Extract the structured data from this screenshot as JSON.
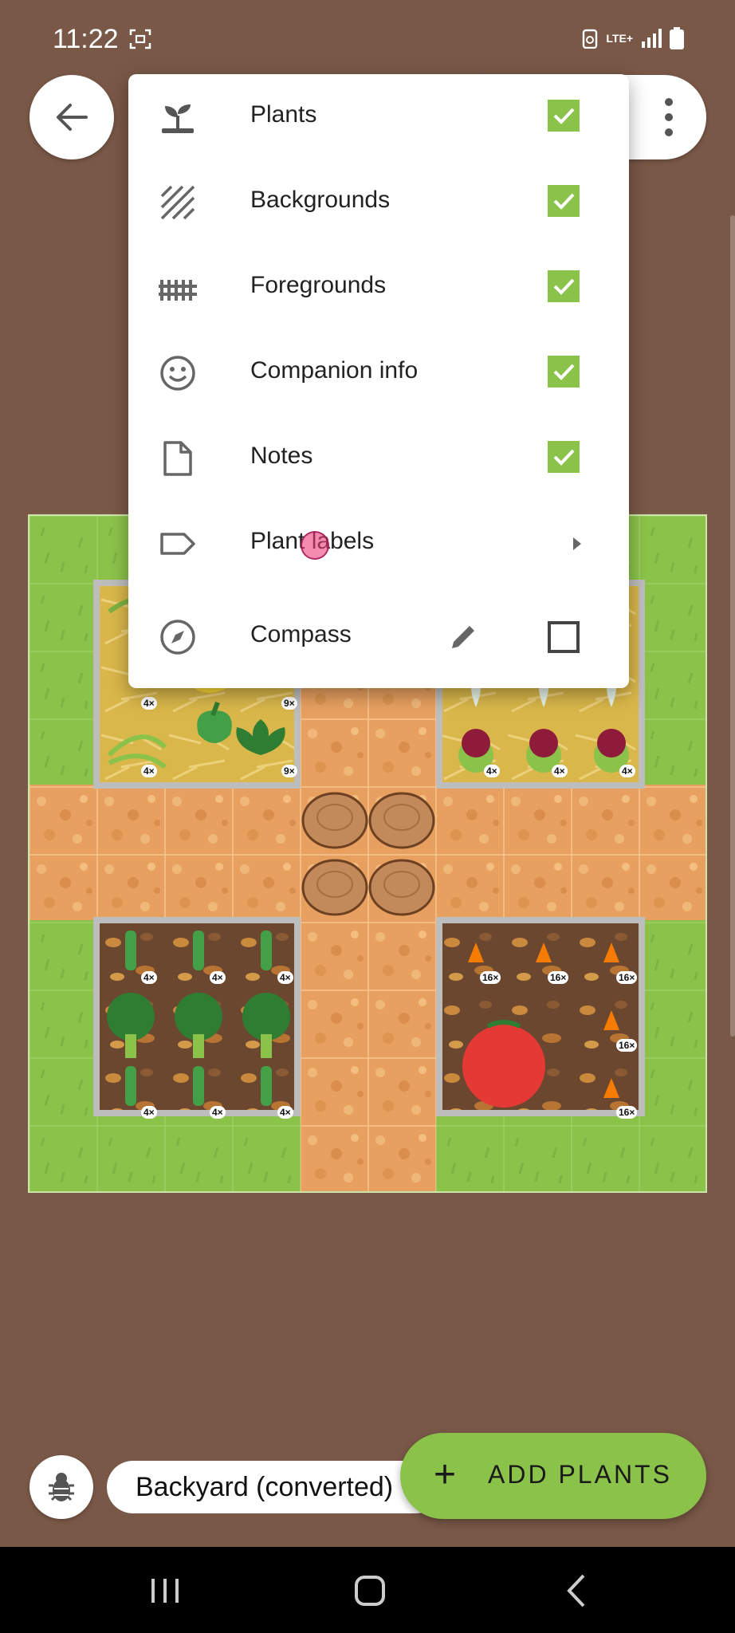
{
  "status_bar": {
    "time": "11:22",
    "network": "LTE+"
  },
  "menu": {
    "items": [
      {
        "label": "Plants",
        "icon": "sprout-icon",
        "checked": true
      },
      {
        "label": "Backgrounds",
        "icon": "hatch-icon",
        "checked": true
      },
      {
        "label": "Foregrounds",
        "icon": "fence-icon",
        "checked": true
      },
      {
        "label": "Companion info",
        "icon": "smiley-icon",
        "checked": true
      },
      {
        "label": "Notes",
        "icon": "note-icon",
        "checked": true
      },
      {
        "label": "Plant labels",
        "icon": "label-icon",
        "submenu": true
      },
      {
        "label": "Compass",
        "icon": "compass-icon",
        "checked": false,
        "edit_icon": "pencil-icon"
      }
    ]
  },
  "garden": {
    "bed_badges": {
      "top_left": [
        "4×",
        "9×",
        "4×",
        "9×"
      ],
      "top_right": [
        "4×",
        "4×",
        "4×"
      ],
      "bottom_left": [
        "4×",
        "4×",
        "4×",
        "4×",
        "4×",
        "4×"
      ],
      "bottom_right": [
        "16×",
        "16×",
        "16×",
        "16×",
        "16×"
      ]
    }
  },
  "bottom_bar": {
    "garden_name": "Backyard (converted)",
    "add_button_label": "ADD PLANTS",
    "add_button_icon": "plus-icon"
  },
  "colors": {
    "background": "#7A5847",
    "accent": "#8BC34A"
  }
}
